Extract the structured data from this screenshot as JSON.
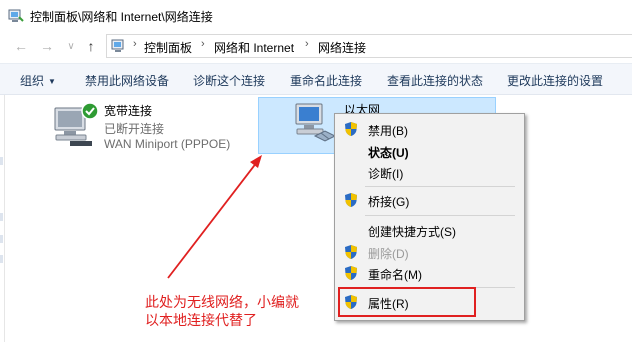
{
  "window": {
    "title": "控制面板\\网络和 Internet\\网络连接"
  },
  "address": {
    "back_icon": "←",
    "forward_icon": "→",
    "history_icon": "∨",
    "up_icon": "↑",
    "crumbs": [
      "控制面板",
      "网络和 Internet",
      "网络连接"
    ],
    "separator": "›"
  },
  "commands": {
    "organize": "组织",
    "organize_caret": "▼",
    "disable_device": "禁用此网络设备",
    "diagnose": "诊断这个连接",
    "rename": "重命名此连接",
    "view_status": "查看此连接的状态",
    "change_settings": "更改此连接的设置"
  },
  "connections": [
    {
      "name": "宽带连接",
      "status": "已断开连接",
      "device": "WAN Miniport (PPPOE)",
      "icon": "network-pc-check-icon"
    },
    {
      "name": "以太网",
      "icon": "network-pc-cable-icon"
    }
  ],
  "context_menu": {
    "disable": "禁用(B)",
    "status": "状态(U)",
    "diagnose": "诊断(I)",
    "bridge": "桥接(G)",
    "create_shortcut": "创建快捷方式(S)",
    "delete": "删除(D)",
    "rename": "重命名(M)",
    "properties": "属性(R)"
  },
  "annotation": {
    "line1": "此处为无线网络，小编就",
    "line2": "以本地连接代替了",
    "color": "#e02020"
  },
  "colors": {
    "selection_bg": "#cce8ff",
    "selection_border": "#99d1ff",
    "command_text": "#1e395b",
    "uac_blue": "#2b6cc4",
    "uac_yellow": "#f2c200"
  }
}
